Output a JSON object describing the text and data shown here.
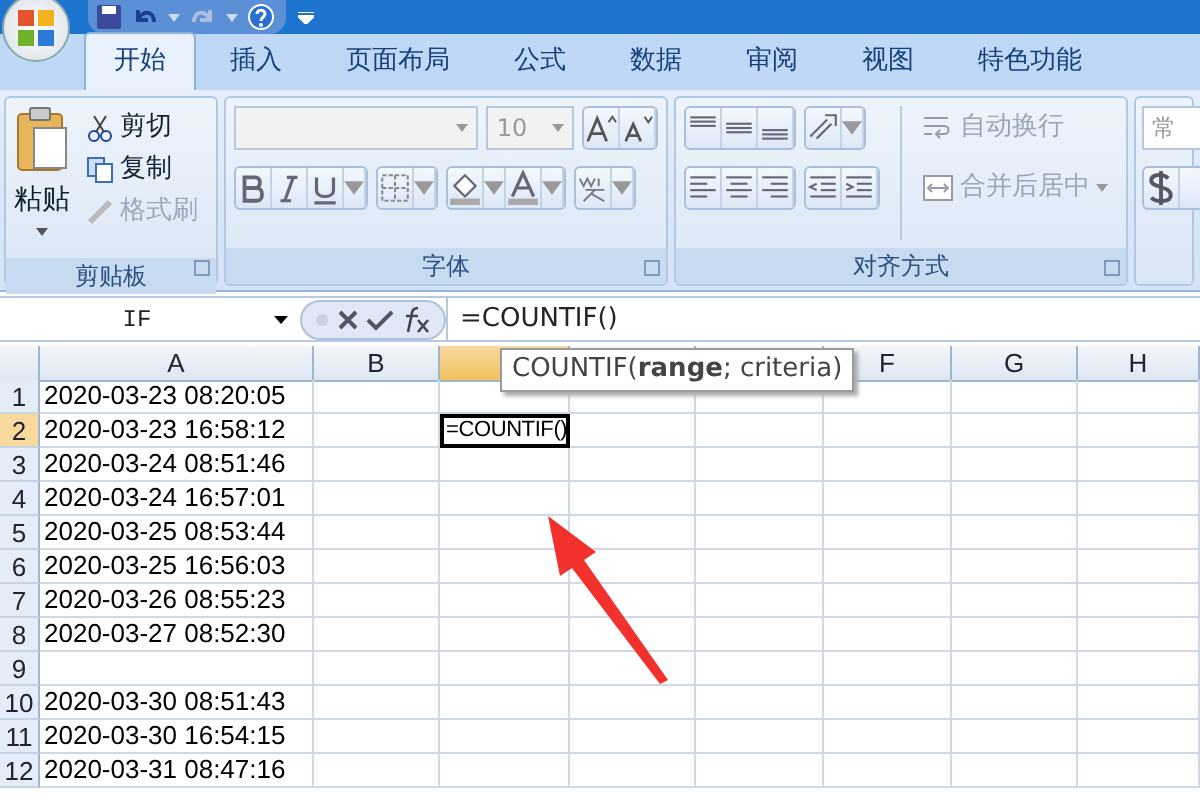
{
  "tabs": [
    {
      "label": "开始",
      "selected": true
    },
    {
      "label": "插入",
      "selected": false
    },
    {
      "label": "页面布局",
      "selected": false
    },
    {
      "label": "公式",
      "selected": false
    },
    {
      "label": "数据",
      "selected": false
    },
    {
      "label": "审阅",
      "selected": false
    },
    {
      "label": "视图",
      "selected": false
    },
    {
      "label": "特色功能",
      "selected": false
    }
  ],
  "ribbon": {
    "clipboard": {
      "title": "剪贴板",
      "paste": "粘贴",
      "items": [
        {
          "label": "剪切",
          "disabled": false
        },
        {
          "label": "复制",
          "disabled": false
        },
        {
          "label": "格式刷",
          "disabled": true
        }
      ]
    },
    "font": {
      "title": "字体",
      "font_size": "10"
    },
    "alignment": {
      "title": "对齐方式",
      "items": [
        {
          "label": "自动换行",
          "disabled": true
        },
        {
          "label": "合并后居中",
          "disabled": true
        }
      ]
    },
    "number": {
      "format": "常"
    }
  },
  "formula_bar": {
    "name_box": "IF",
    "formula": "=COUNTIF()"
  },
  "sheet": {
    "columns": [
      {
        "label": "A",
        "selected": false
      },
      {
        "label": "B",
        "selected": false
      },
      {
        "selected": true
      },
      {
        "selected": false
      },
      {
        "selected": false
      },
      {
        "label": "F",
        "selected": false
      },
      {
        "label": "G",
        "selected": false
      },
      {
        "label": "H",
        "selected": false
      }
    ],
    "rows": [
      {
        "number": "1",
        "selected": false,
        "value": "2020-03-23 08:20:05"
      },
      {
        "number": "2",
        "selected": true,
        "value": "2020-03-23 16:58:12",
        "editing_value": "=COUNTIF()"
      },
      {
        "number": "3",
        "selected": false,
        "value": "2020-03-24 08:51:46"
      },
      {
        "number": "4",
        "selected": false,
        "value": "2020-03-24 16:57:01"
      },
      {
        "number": "5",
        "selected": false,
        "value": "2020-03-25 08:53:44"
      },
      {
        "number": "6",
        "selected": false,
        "value": "2020-03-25 16:56:03"
      },
      {
        "number": "7",
        "selected": false,
        "value": "2020-03-26 08:55:23"
      },
      {
        "number": "8",
        "selected": false,
        "value": "2020-03-27 08:52:30"
      },
      {
        "number": "9",
        "selected": false
      },
      {
        "number": "10",
        "selected": false,
        "value": "2020-03-30 08:51:43"
      },
      {
        "number": "11",
        "selected": false,
        "value": "2020-03-30 16:54:15"
      },
      {
        "number": "12",
        "selected": false,
        "value": "2020-03-31 08:47:16"
      }
    ],
    "tooltip": "COUNTIF(**range**; criteria)"
  }
}
